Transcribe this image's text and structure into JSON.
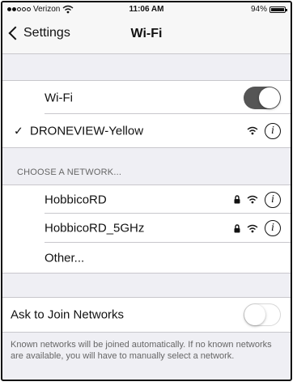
{
  "statusbar": {
    "carrier": "Verizon",
    "time": "11:06 AM",
    "battery": "94%",
    "battery_fraction": 0.94
  },
  "navbar": {
    "back_label": "Settings",
    "title": "Wi-Fi"
  },
  "wifi_toggle": {
    "label": "Wi-Fi",
    "on": true
  },
  "connected": {
    "check": "✓",
    "name": "DRONEVIEW-Yellow"
  },
  "choose_header": "CHOOSE A NETWORK...",
  "networks": [
    {
      "name": "HobbicoRD",
      "locked": true
    },
    {
      "name": "HobbicoRD_5GHz",
      "locked": true
    },
    {
      "name": "Other..."
    }
  ],
  "ask_join": {
    "label": "Ask to Join Networks",
    "on": false
  },
  "footer_text": "Known networks will be joined automatically. If no known networks are available, you will have to manually select a network.",
  "info_glyph": "i"
}
